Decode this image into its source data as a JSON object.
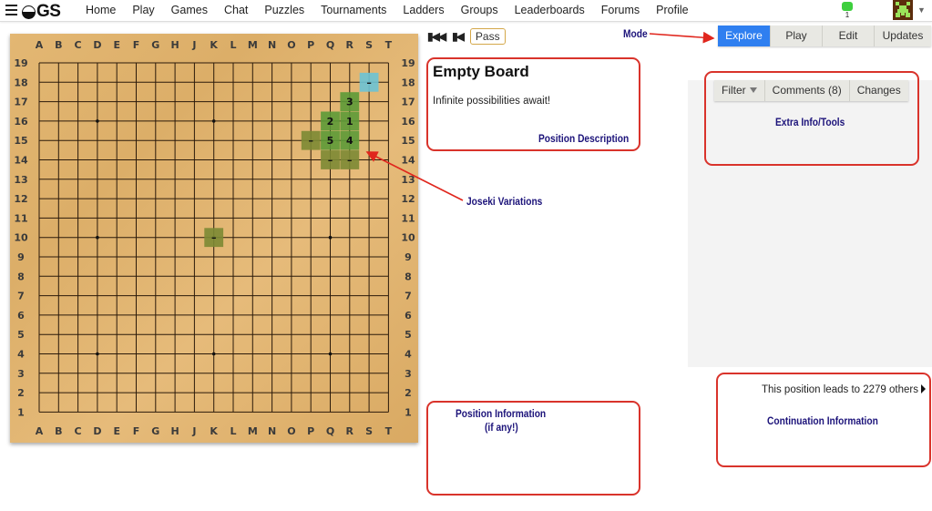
{
  "header": {
    "logo_text": "GS",
    "nav": [
      "Home",
      "Play",
      "Games",
      "Chat",
      "Puzzles",
      "Tournaments",
      "Ladders",
      "Groups",
      "Leaderboards",
      "Forums",
      "Profile"
    ],
    "notifications_count": "1",
    "accent_color": "#2f7ff0"
  },
  "board": {
    "size": 19,
    "columns": [
      "A",
      "B",
      "C",
      "D",
      "E",
      "F",
      "G",
      "H",
      "J",
      "K",
      "L",
      "M",
      "N",
      "O",
      "P",
      "Q",
      "R",
      "S",
      "T"
    ],
    "rows": [
      "19",
      "18",
      "17",
      "16",
      "15",
      "14",
      "13",
      "12",
      "11",
      "10",
      "9",
      "8",
      "7",
      "6",
      "5",
      "4",
      "3",
      "2",
      "1"
    ],
    "star_points": [
      "D16",
      "K16",
      "Q16",
      "D10",
      "K10",
      "Q10",
      "D4",
      "K4",
      "Q4"
    ],
    "markers": [
      {
        "point": "S18",
        "label": "–",
        "color": "#6cc3d5",
        "kind": "current"
      },
      {
        "point": "R17",
        "label": "3",
        "color": "#5c9a37",
        "kind": "good"
      },
      {
        "point": "Q16",
        "label": "2",
        "color": "#5c9a37",
        "kind": "good"
      },
      {
        "point": "R16",
        "label": "1",
        "color": "#5c9a37",
        "kind": "good"
      },
      {
        "point": "Q15",
        "label": "5",
        "color": "#5c9a37",
        "kind": "good"
      },
      {
        "point": "R15",
        "label": "4",
        "color": "#5c9a37",
        "kind": "good"
      },
      {
        "point": "P15",
        "label": "–",
        "color": "#7c8a34",
        "kind": "ok"
      },
      {
        "point": "Q14",
        "label": "–",
        "color": "#7c8a34",
        "kind": "ok"
      },
      {
        "point": "R14",
        "label": "–",
        "color": "#7c8a34",
        "kind": "ok"
      },
      {
        "point": "K10",
        "label": "–",
        "color": "#7c8a34",
        "kind": "ok"
      }
    ]
  },
  "controls": {
    "first_label": "⏮",
    "prev_label": "⏴",
    "pass_label": "Pass"
  },
  "modes": [
    {
      "label": "Explore",
      "active": true
    },
    {
      "label": "Play",
      "active": false
    },
    {
      "label": "Edit",
      "active": false
    },
    {
      "label": "Updates",
      "active": false
    }
  ],
  "description": {
    "title": "Empty Board",
    "text": "Infinite possibilities await!"
  },
  "extra_tabs": [
    {
      "label": "Filter",
      "icon": "filter-icon"
    },
    {
      "label": "Comments (8)"
    },
    {
      "label": "Changes"
    }
  ],
  "continuation": {
    "text": "This position leads to 2279 others"
  },
  "annotations": {
    "mode": "Mode",
    "position_description": "Position Description",
    "extra_info": "Extra Info/Tools",
    "joseki_variations": "Joseki Variations",
    "position_information_line1": "Position Information",
    "position_information_line2": "(if any!)",
    "continuation_information": "Continuation Information",
    "annotation_color": "#1c137a",
    "box_color": "#d9332b"
  }
}
